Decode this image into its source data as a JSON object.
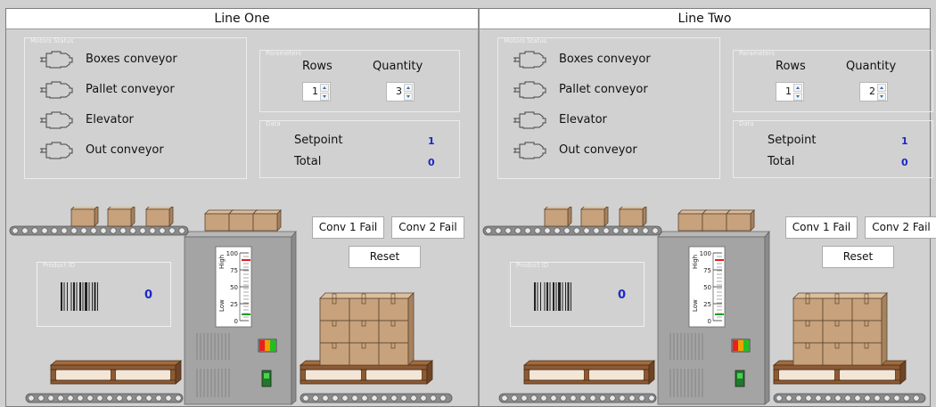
{
  "lines": [
    {
      "title": "Line One",
      "motors_label": "Motors Status",
      "motors": [
        "Boxes conveyor",
        "Pallet conveyor",
        "Elevator",
        "Out conveyor"
      ],
      "parameters_label": "Parameters",
      "rows_label": "Rows",
      "quantity_label": "Quantity",
      "rows_value": "1",
      "quantity_value": "3",
      "data_label": "Data",
      "setpoint_label": "Setpoint",
      "setpoint_value": "1",
      "total_label": "Total",
      "total_value": "0",
      "conv1_fail": "Conv 1 Fail",
      "conv2_fail": "Conv 2 Fail",
      "reset": "Reset",
      "product_id_label": "Product ID",
      "product_id_value": "0",
      "gauge": {
        "high": "High",
        "low": "Low",
        "ticks": [
          "100",
          "75",
          "50",
          "25",
          "0"
        ]
      }
    },
    {
      "title": "Line Two",
      "motors_label": "Motors Status",
      "motors": [
        "Boxes conveyor",
        "Pallet conveyor",
        "Elevator",
        "Out conveyor"
      ],
      "parameters_label": "Parameters",
      "rows_label": "Rows",
      "quantity_label": "Quantity",
      "rows_value": "1",
      "quantity_value": "2",
      "data_label": "Data",
      "setpoint_label": "Setpoint",
      "setpoint_value": "1",
      "total_label": "Total",
      "total_value": "0",
      "conv1_fail": "Conv 1 Fail",
      "conv2_fail": "Conv 2 Fail",
      "reset": "Reset",
      "product_id_label": "Product ID",
      "product_id_value": "0",
      "gauge": {
        "high": "High",
        "low": "Low",
        "ticks": [
          "100",
          "75",
          "50",
          "25",
          "0"
        ]
      }
    }
  ],
  "colors": {
    "value_blue": "#1a28c8",
    "box": "#c8a27c",
    "pallet": "#8c5a34",
    "machine": "#a4a4a4"
  }
}
